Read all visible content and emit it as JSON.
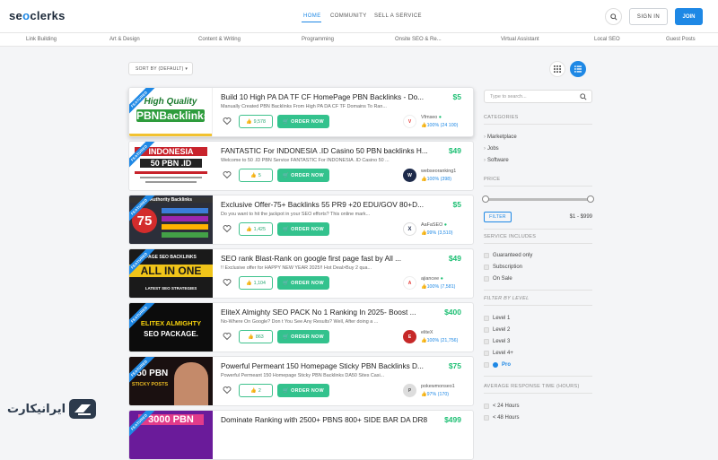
{
  "logo": {
    "prefix": "se",
    "o": "o",
    "suffix": "clerks"
  },
  "nav": {
    "home": "HOME",
    "community": "COMMUNITY",
    "sell": "SELL A SERVICE",
    "signin": "SIGN IN",
    "join": "JOIN"
  },
  "categories": [
    "Link Building",
    "Art & Design",
    "Content & Writing",
    "Programming",
    "Onsite SEO & Re...",
    "Virtual Assistant",
    "Local SEO",
    "Guest Posts"
  ],
  "sort_label": "SORT BY (DEFAULT) ▾",
  "order_label": "ORDER NOW",
  "listings": [
    {
      "title": "Build 10 High PA DA TF CF HomePage PBN Backlinks - Do...",
      "desc": "Manually Created PBN Backlinks From High PA DA CF TF Domains To Ran...",
      "price": "$5",
      "likes": "9,578",
      "seller": "Vfmseo",
      "rating": "100% (24 100)",
      "thumb_line1": "High Quality",
      "thumb_line2": "PBNBacklinks",
      "badge": "FEATURED",
      "accent": "#f2c230"
    },
    {
      "title": "FANTASTIC For INDONESIA .ID Casino 50 PBN backlinks H...",
      "desc": "Welcome to 50 .ID PBN Service FANTASTIC For INDONESIA .ID Casino 50 ...",
      "price": "$49",
      "likes": "5",
      "seller": "webseoranking1",
      "rating": "100% (398)",
      "thumb_line1": "INDONESIA",
      "thumb_line2": "50 PBN .ID",
      "badge": "FEATURED",
      "accent": "#d9232e"
    },
    {
      "title": "Exclusive Offer-75+ Backlinks 55 PR9 +20 EDU/GOV 80+D...",
      "desc": "Do you want to hit the jackpot in your SEO efforts? This online mark...",
      "price": "$5",
      "likes": "1,425",
      "seller": "AaFaSEO",
      "rating": "99% (3,510)",
      "thumb_line1": "75",
      "thumb_line2": "Authority Backlinks",
      "badge": "FEATURED",
      "accent": "#d32c2c"
    },
    {
      "title": "SEO rank Blast-Rank on google first page fast by All ...",
      "desc": "!! Exclusive offer for HAPPY NEW YEAR 2025!! Hot Deal>Buy 2 qua...",
      "price": "$49",
      "likes": "1,104",
      "seller": "ajiancee",
      "rating": "100% (7,581)",
      "thumb_line1": "ALL IN ONE",
      "thumb_line2": "LATEST SEO STRATEGIES",
      "badge": "FEATURED",
      "accent": "#f0c419"
    },
    {
      "title": "EliteX Almighty SEO PACK No 1 Ranking In 2025- Boost ...",
      "desc": "No-Where On Google? Don t You See Any Results? Well, After doing a ...",
      "price": "$400",
      "likes": "863",
      "seller": "eliteX",
      "rating": "100% (21,756)",
      "thumb_line1": "ELITEX ALMIGHTY",
      "thumb_line2": "SEO PACKAGE.",
      "badge": "FEATURED",
      "accent": "#f5d10c"
    },
    {
      "title": "Powerful Permeant 150 Homepage Sticky PBN Backlinks D...",
      "desc": "Powerful Permeant 150 Homepage Sticky PBN Backlinks DA50 Sites Casi...",
      "price": "$75",
      "likes": "2",
      "seller": "pokewmonseo1",
      "rating": "97% (170)",
      "thumb_line1": "150 PBN",
      "thumb_line2": "STICKY POSTS",
      "badge": "FEATURED",
      "accent": "#e8b923"
    },
    {
      "title": "Dominate Ranking with 2500+ PBNS 800+ SIDE BAR DA DR8...",
      "desc": "",
      "price": "$499",
      "likes": "",
      "seller": "",
      "rating": "",
      "thumb_line1": "3000 PBN",
      "thumb_line2": "",
      "badge": "FEATURED",
      "accent": "#e23b8a"
    }
  ],
  "sidebar": {
    "search_placeholder": "Type to search...",
    "categories_heading": "CATEGORIES",
    "category_items": [
      "Marketplace",
      "Jobs",
      "Software"
    ],
    "price_heading": "PRICE",
    "filter_label": "FILTER",
    "price_range": "$1 - $999",
    "service_heading": "SERVICE INCLUDES",
    "service_items": [
      "Guaranteed only",
      "Subscription",
      "On Sale"
    ],
    "level_heading": "FILTER BY LEVEL",
    "level_items": [
      "Level 1",
      "Level 2",
      "Level 3",
      "Level 4+",
      "Pro"
    ],
    "response_heading": "AVERAGE RESPONSE TIME (HOURS)",
    "response_items": [
      "< 24 Hours",
      "< 48 Hours"
    ]
  },
  "watermark": "ایرانیکارت",
  "colors": {
    "accent_blue": "#1e88e5",
    "green": "#33c28d",
    "price_green": "#1dbf73"
  }
}
